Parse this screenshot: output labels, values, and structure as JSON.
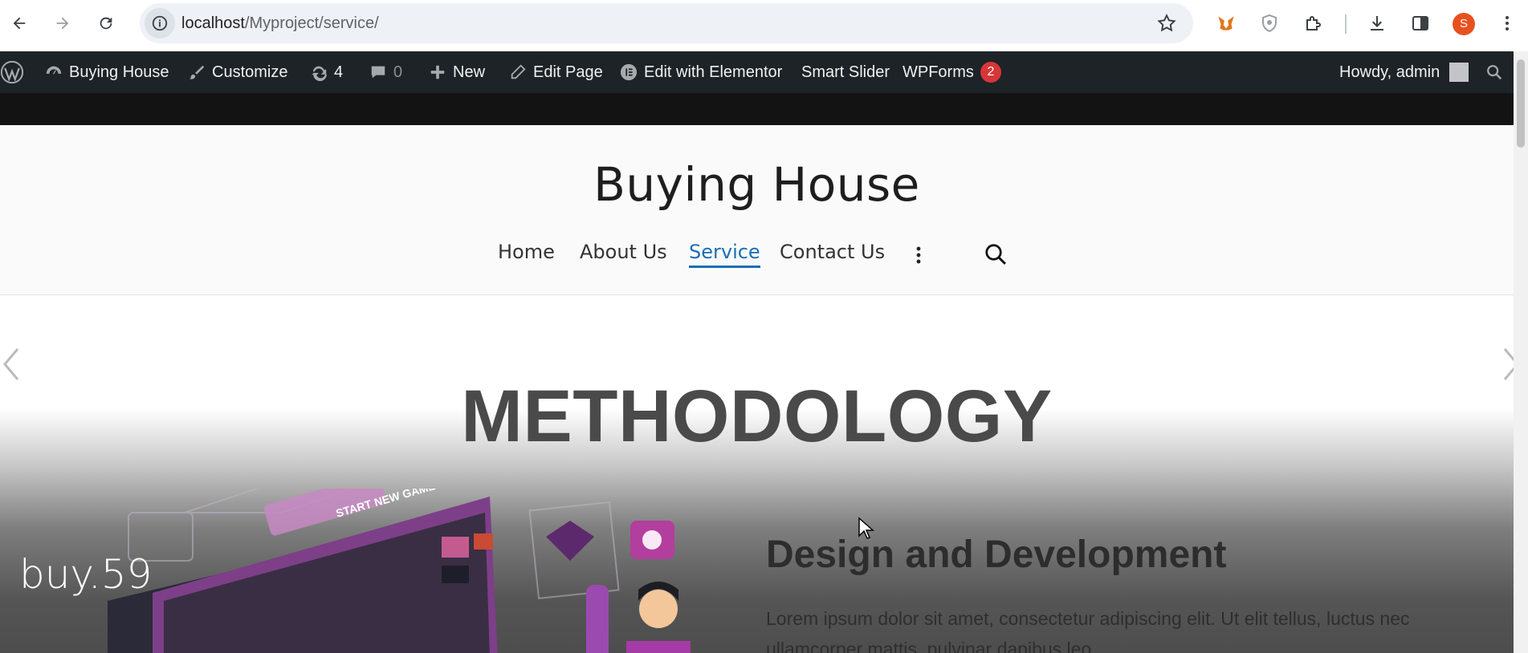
{
  "browser": {
    "url_host": "localhost",
    "url_path": "/Myproject/service/",
    "profile_initial": "S"
  },
  "adminbar": {
    "site_name": "Buying House",
    "customize": "Customize",
    "updates_count": "4",
    "comments_count": "0",
    "new": "New",
    "edit_page": "Edit Page",
    "edit_elementor": "Edit with Elementor",
    "smart_slider": "Smart Slider",
    "wpforms": "WPForms",
    "wpforms_badge": "2",
    "howdy": "Howdy, admin"
  },
  "site": {
    "title": "Buying House",
    "menu": [
      "Home",
      "About Us",
      "Service",
      "Contact Us"
    ]
  },
  "hero": {
    "heading": "METHODOLOGY",
    "caption": "buy.59",
    "sub_heading": "Design and Development",
    "paragraph": "Lorem ipsum dolor sit amet, consectetur adipiscing elit. Ut elit tellus, luctus nec ullamcorper mattis, pulvinar dapibus leo.",
    "illustration_text": "START NEW GAME"
  },
  "colors": {
    "adminbar_bg": "#1d2327",
    "menu_active": "#1a6eb5",
    "badge": "#d63638"
  }
}
